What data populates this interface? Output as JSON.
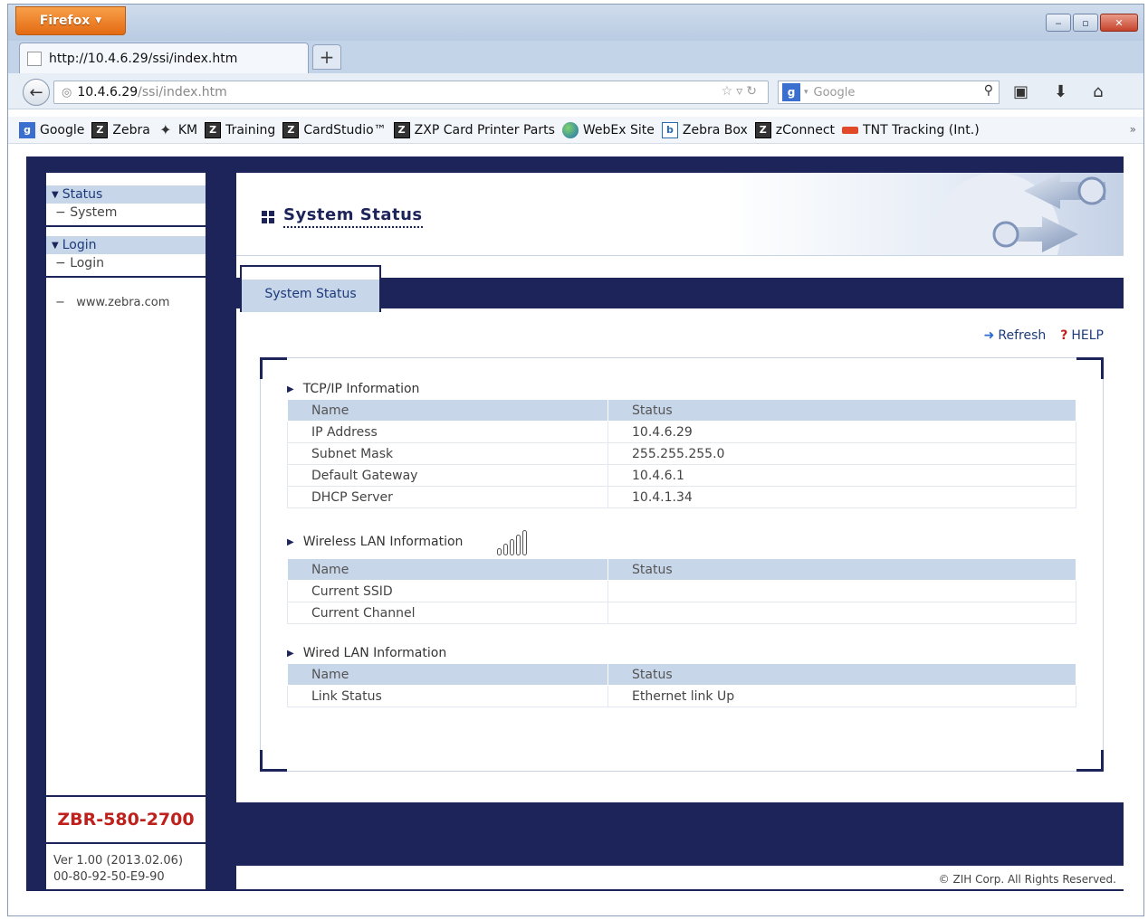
{
  "browser": {
    "menu_button": "Firefox",
    "tab_title": "http://10.4.6.29/ssi/index.htm",
    "new_tab": "+",
    "url_host": "10.4.6.29",
    "url_path": "/ssi/index.htm",
    "search_placeholder": "Google",
    "bookmarks": [
      {
        "label": "Google",
        "icon": "google-icon"
      },
      {
        "label": "Zebra",
        "icon": "zebra-icon"
      },
      {
        "label": "KM",
        "icon": "km-icon"
      },
      {
        "label": "Training",
        "icon": "zebra-icon"
      },
      {
        "label": "CardStudio™",
        "icon": "zebra-icon"
      },
      {
        "label": "ZXP Card Printer Parts",
        "icon": "zebra-icon"
      },
      {
        "label": "WebEx Site",
        "icon": "globe-icon"
      },
      {
        "label": "Zebra Box",
        "icon": "box-icon"
      },
      {
        "label": "zConnect",
        "icon": "zebra-icon"
      },
      {
        "label": "TNT Tracking (Int.)",
        "icon": "tnt-icon"
      }
    ],
    "overflow": "»"
  },
  "sidebar": {
    "status_header": "Status",
    "status_item": "System",
    "login_header": "Login",
    "login_item": "Login",
    "link": "www.zebra.com",
    "model": "ZBR-580-2700",
    "version": "Ver 1.00 (2013.02.06)",
    "mac": "00-80-92-50-E9-90"
  },
  "main": {
    "title": "System Status",
    "tab": "System Status",
    "refresh": "Refresh",
    "help": "HELP",
    "copyright": "© ZIH Corp. All Rights Reserved."
  },
  "tcpip": {
    "title": "TCP/IP Information",
    "headers": [
      "Name",
      "Status"
    ],
    "rows": [
      [
        "IP Address",
        "10.4.6.29"
      ],
      [
        "Subnet Mask",
        "255.255.255.0"
      ],
      [
        "Default Gateway",
        "10.4.6.1"
      ],
      [
        "DHCP Server",
        "10.4.1.34"
      ]
    ]
  },
  "wireless": {
    "title": "Wireless LAN Information",
    "signal_bars": 0,
    "headers": [
      "Name",
      "Status"
    ],
    "rows": [
      [
        "Current SSID",
        ""
      ],
      [
        "Current Channel",
        ""
      ]
    ]
  },
  "wired": {
    "title": "Wired LAN Information",
    "headers": [
      "Name",
      "Status"
    ],
    "rows": [
      [
        "Link Status",
        "Ethernet link Up"
      ]
    ]
  },
  "colors": {
    "navy": "#1c2459",
    "header_blue": "#c8d6ea",
    "model_red": "#c0201c"
  }
}
